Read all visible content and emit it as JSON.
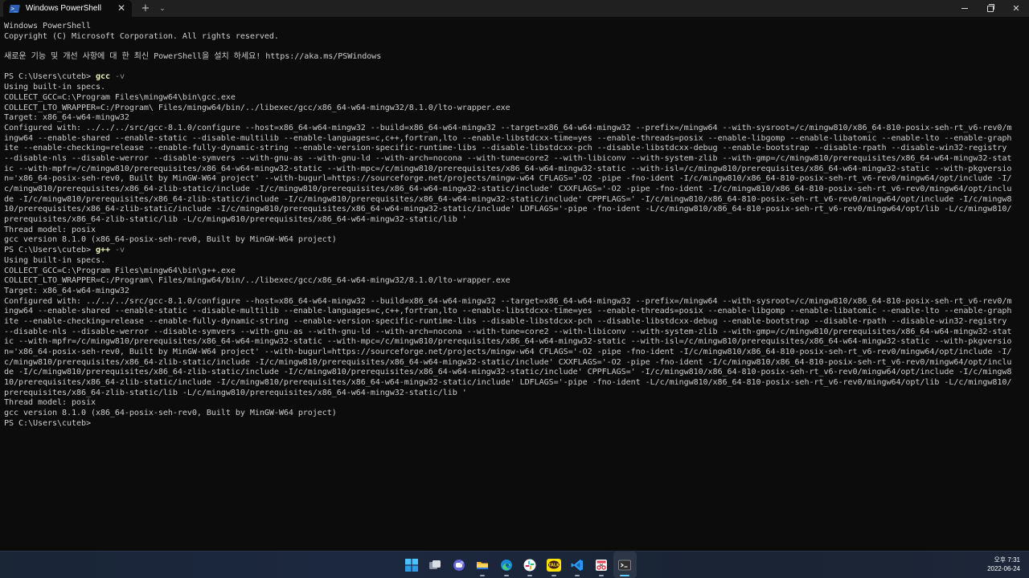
{
  "tab": {
    "title": "Windows PowerShell",
    "close_glyph": "✕",
    "new_tab_glyph": "+",
    "dropdown_glyph": "⌄"
  },
  "window_controls": {
    "close_glyph": "✕"
  },
  "terminal": {
    "lines": [
      "Windows PowerShell",
      "Copyright (C) Microsoft Corporation. All rights reserved.",
      "",
      "새로운 기능 및 개선 사항에 대 한 최신 PowerShell을 설치 하세요! https://aka.ms/PSWindows",
      "",
      {
        "prompt": "PS C:\\Users\\cuteb> ",
        "cmd": "gcc",
        "arg": " -v"
      },
      "Using built-in specs.",
      "COLLECT_GCC=C:\\Program Files\\mingw64\\bin\\gcc.exe",
      "COLLECT_LTO_WRAPPER=C:/Program\\ Files/mingw64/bin/../libexec/gcc/x86_64-w64-mingw32/8.1.0/lto-wrapper.exe",
      "Target: x86_64-w64-mingw32",
      "Configured with: ../../../src/gcc-8.1.0/configure --host=x86_64-w64-mingw32 --build=x86_64-w64-mingw32 --target=x86_64-w64-mingw32 --prefix=/mingw64 --with-sysroot=/c/mingw810/x86_64-810-posix-seh-rt_v6-rev0/m",
      "ingw64 --enable-shared --enable-static --disable-multilib --enable-languages=c,c++,fortran,lto --enable-libstdcxx-time=yes --enable-threads=posix --enable-libgomp --enable-libatomic --enable-lto --enable-graph",
      "ite --enable-checking=release --enable-fully-dynamic-string --enable-version-specific-runtime-libs --disable-libstdcxx-pch --disable-libstdcxx-debug --enable-bootstrap --disable-rpath --disable-win32-registry",
      "--disable-nls --disable-werror --disable-symvers --with-gnu-as --with-gnu-ld --with-arch=nocona --with-tune=core2 --with-libiconv --with-system-zlib --with-gmp=/c/mingw810/prerequisites/x86_64-w64-mingw32-stat",
      "ic --with-mpfr=/c/mingw810/prerequisites/x86_64-w64-mingw32-static --with-mpc=/c/mingw810/prerequisites/x86_64-w64-mingw32-static --with-isl=/c/mingw810/prerequisites/x86_64-w64-mingw32-static --with-pkgversio",
      "n='x86_64-posix-seh-rev0, Built by MinGW-W64 project' --with-bugurl=https://sourceforge.net/projects/mingw-w64 CFLAGS='-O2 -pipe -fno-ident -I/c/mingw810/x86_64-810-posix-seh-rt_v6-rev0/mingw64/opt/include -I/",
      "c/mingw810/prerequisites/x86_64-zlib-static/include -I/c/mingw810/prerequisites/x86_64-w64-mingw32-static/include' CXXFLAGS='-O2 -pipe -fno-ident -I/c/mingw810/x86_64-810-posix-seh-rt_v6-rev0/mingw64/opt/inclu",
      "de -I/c/mingw810/prerequisites/x86_64-zlib-static/include -I/c/mingw810/prerequisites/x86_64-w64-mingw32-static/include' CPPFLAGS=' -I/c/mingw810/x86_64-810-posix-seh-rt_v6-rev0/mingw64/opt/include -I/c/mingw8",
      "10/prerequisites/x86_64-zlib-static/include -I/c/mingw810/prerequisites/x86_64-w64-mingw32-static/include' LDFLAGS='-pipe -fno-ident -L/c/mingw810/x86_64-810-posix-seh-rt_v6-rev0/mingw64/opt/lib -L/c/mingw810/",
      "prerequisites/x86_64-zlib-static/lib -L/c/mingw810/prerequisites/x86_64-w64-mingw32-static/lib '",
      "Thread model: posix",
      "gcc version 8.1.0 (x86_64-posix-seh-rev0, Built by MinGW-W64 project)",
      {
        "prompt": "PS C:\\Users\\cuteb> ",
        "cmd": "g++",
        "arg": " -v"
      },
      "Using built-in specs.",
      "COLLECT_GCC=C:\\Program Files\\mingw64\\bin\\g++.exe",
      "COLLECT_LTO_WRAPPER=C:/Program\\ Files/mingw64/bin/../libexec/gcc/x86_64-w64-mingw32/8.1.0/lto-wrapper.exe",
      "Target: x86_64-w64-mingw32",
      "Configured with: ../../../src/gcc-8.1.0/configure --host=x86_64-w64-mingw32 --build=x86_64-w64-mingw32 --target=x86_64-w64-mingw32 --prefix=/mingw64 --with-sysroot=/c/mingw810/x86_64-810-posix-seh-rt_v6-rev0/m",
      "ingw64 --enable-shared --enable-static --disable-multilib --enable-languages=c,c++,fortran,lto --enable-libstdcxx-time=yes --enable-threads=posix --enable-libgomp --enable-libatomic --enable-lto --enable-graph",
      "ite --enable-checking=release --enable-fully-dynamic-string --enable-version-specific-runtime-libs --disable-libstdcxx-pch --disable-libstdcxx-debug --enable-bootstrap --disable-rpath --disable-win32-registry",
      "--disable-nls --disable-werror --disable-symvers --with-gnu-as --with-gnu-ld --with-arch=nocona --with-tune=core2 --with-libiconv --with-system-zlib --with-gmp=/c/mingw810/prerequisites/x86_64-w64-mingw32-stat",
      "ic --with-mpfr=/c/mingw810/prerequisites/x86_64-w64-mingw32-static --with-mpc=/c/mingw810/prerequisites/x86_64-w64-mingw32-static --with-isl=/c/mingw810/prerequisites/x86_64-w64-mingw32-static --with-pkgversio",
      "n='x86_64-posix-seh-rev0, Built by MinGW-W64 project' --with-bugurl=https://sourceforge.net/projects/mingw-w64 CFLAGS='-O2 -pipe -fno-ident -I/c/mingw810/x86_64-810-posix-seh-rt_v6-rev0/mingw64/opt/include -I/",
      "c/mingw810/prerequisites/x86_64-zlib-static/include -I/c/mingw810/prerequisites/x86_64-w64-mingw32-static/include' CXXFLAGS='-O2 -pipe -fno-ident -I/c/mingw810/x86_64-810-posix-seh-rt_v6-rev0/mingw64/opt/inclu",
      "de -I/c/mingw810/prerequisites/x86_64-zlib-static/include -I/c/mingw810/prerequisites/x86_64-w64-mingw32-static/include' CPPFLAGS=' -I/c/mingw810/x86_64-810-posix-seh-rt_v6-rev0/mingw64/opt/include -I/c/mingw8",
      "10/prerequisites/x86_64-zlib-static/include -I/c/mingw810/prerequisites/x86_64-w64-mingw32-static/include' LDFLAGS='-pipe -fno-ident -L/c/mingw810/x86_64-810-posix-seh-rt_v6-rev0/mingw64/opt/lib -L/c/mingw810/",
      "prerequisites/x86_64-zlib-static/lib -L/c/mingw810/prerequisites/x86_64-w64-mingw32-static/lib '",
      "Thread model: posix",
      "gcc version 8.1.0 (x86_64-posix-seh-rev0, Built by MinGW-W64 project)",
      {
        "prompt": "PS C:\\Users\\cuteb>",
        "cmd": "",
        "arg": ""
      }
    ]
  },
  "taskbar": {
    "apps": [
      {
        "name": "start",
        "icon": "windows-logo-icon",
        "running": false,
        "active": false
      },
      {
        "name": "task-view",
        "icon": "task-view-icon",
        "running": false,
        "active": false
      },
      {
        "name": "chat",
        "icon": "chat-icon",
        "running": false,
        "active": false
      },
      {
        "name": "file-explorer",
        "icon": "folder-icon",
        "running": true,
        "active": false
      },
      {
        "name": "edge",
        "icon": "edge-icon",
        "running": true,
        "active": false
      },
      {
        "name": "slack",
        "icon": "slack-icon",
        "running": true,
        "active": false
      },
      {
        "name": "kakaotalk",
        "icon": "kakaotalk-icon",
        "running": true,
        "active": false,
        "badge": "TALK"
      },
      {
        "name": "vscode",
        "icon": "vscode-icon",
        "running": true,
        "active": false
      },
      {
        "name": "snipping-tool",
        "icon": "snipping-tool-icon",
        "running": true,
        "active": false
      },
      {
        "name": "terminal",
        "icon": "terminal-icon",
        "running": true,
        "active": true
      }
    ],
    "clock": {
      "time": "오후 7:31",
      "date": "2022-06-24"
    }
  },
  "colors": {
    "terminal_bg": "#0c0c0c",
    "terminal_fg": "#cccccc",
    "command": "#f2f2c0",
    "arg": "#8a8a8a",
    "accent": "#60cdff"
  }
}
